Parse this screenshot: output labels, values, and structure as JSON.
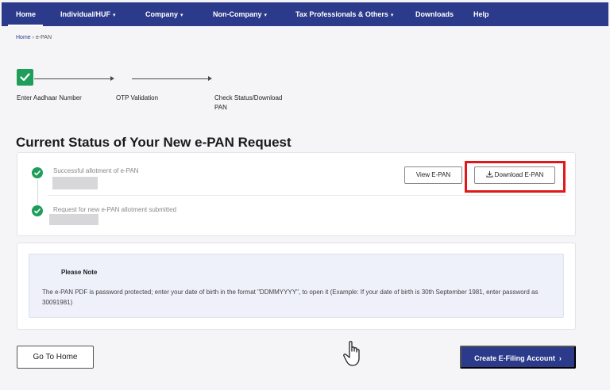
{
  "nav": {
    "items": [
      {
        "label": "Home",
        "active": true,
        "dropdown": false
      },
      {
        "label": "Individual/HUF",
        "dropdown": true
      },
      {
        "label": "Company",
        "dropdown": true
      },
      {
        "label": "Non-Company",
        "dropdown": true
      },
      {
        "label": "Tax Professionals & Others",
        "dropdown": true
      },
      {
        "label": "Downloads",
        "dropdown": false
      },
      {
        "label": "Help",
        "dropdown": false
      }
    ]
  },
  "breadcrumb": {
    "home": "Home",
    "separator": "›",
    "current": "e-PAN"
  },
  "steps": [
    {
      "label": "Enter Aadhaar Number",
      "completed": true
    },
    {
      "label": "OTP Validation",
      "completed": false
    },
    {
      "label_line1": "Check Status/Download",
      "label_line2": "PAN",
      "completed": false
    }
  ],
  "page_title": "Current Status of Your New e-PAN Request",
  "status": {
    "items": [
      {
        "text": "Successful allotment of e-PAN",
        "completed": true
      },
      {
        "text": "Request for new e-PAN allotment submitted",
        "completed": true
      }
    ],
    "view_button": "View E-PAN",
    "download_button": "Download E-PAN"
  },
  "note": {
    "title": "Please Note",
    "body": "The e-PAN PDF is password protected; enter your date of birth in the format \"DDMMYYYY\", to open it (Example: If your date of birth is 30th September 1981, enter password as 30091981)"
  },
  "footer": {
    "home_button": "Go To Home",
    "create_button": "Create E-Filing Account",
    "create_chevron": "›"
  },
  "colors": {
    "brand": "#2b3a8a",
    "success": "#1f9e5b",
    "highlight": "#e01818",
    "background": "#f5f5f7"
  }
}
